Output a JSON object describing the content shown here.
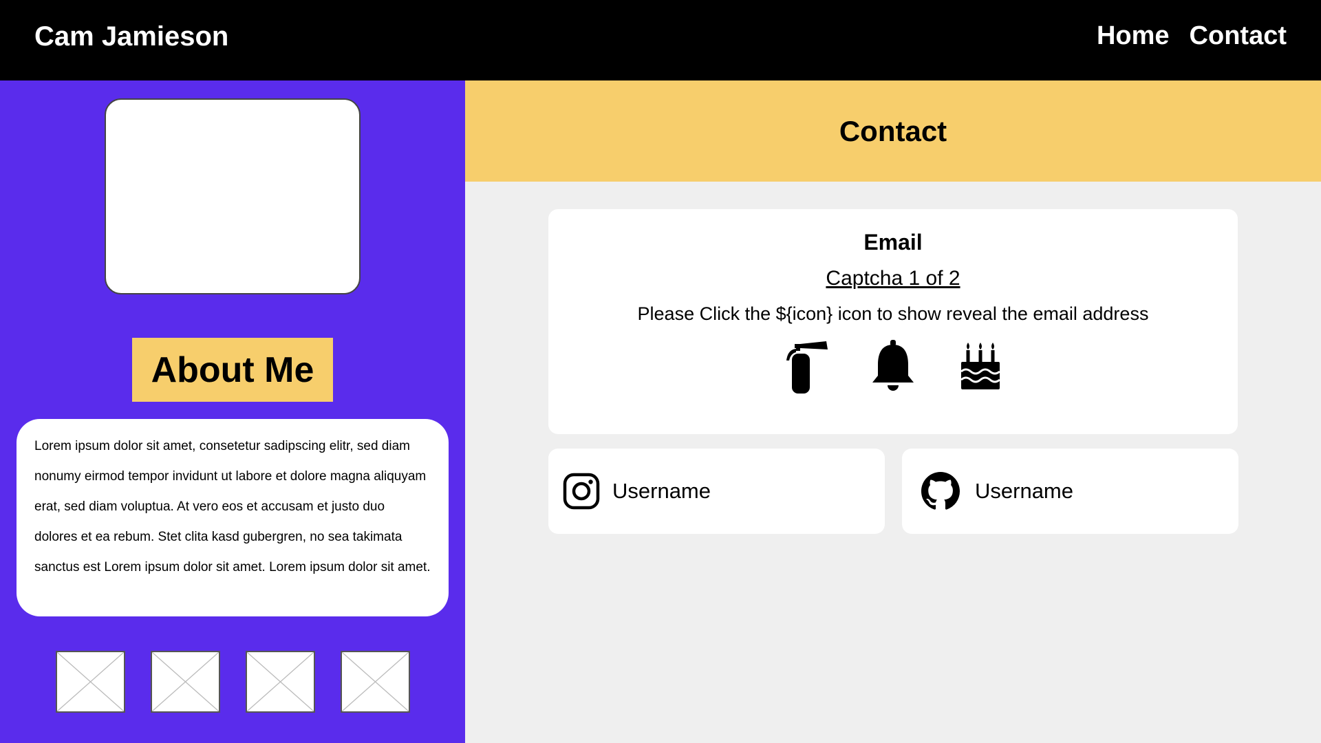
{
  "colors": {
    "topbar": "#000000",
    "sidebar": "#5a2cec",
    "accent": "#f7ce6c",
    "content_bg": "#efefef",
    "card": "#ffffff"
  },
  "header": {
    "brand": "Cam Jamieson",
    "nav": [
      {
        "label": "Home"
      },
      {
        "label": "Contact"
      }
    ]
  },
  "sidebar": {
    "about_title": "About Me",
    "bio": "Lorem ipsum dolor sit amet, consetetur sadipscing elitr, sed diam nonumy eirmod tempor invidunt ut labore et dolore magna aliquyam erat, sed diam voluptua. At vero eos et accusam et justo duo dolores et ea rebum. Stet clita kasd gubergren, no sea takimata sanctus est Lorem ipsum dolor sit amet. Lorem ipsum dolor sit amet.",
    "gallery_count": 4
  },
  "main": {
    "title": "Contact",
    "email": {
      "title": "Email",
      "captcha_link": "Captcha 1 of 2",
      "instruction": "Please Click the ${icon} icon to show reveal the email address",
      "icons": [
        "fire-extinguisher-icon",
        "bell-icon",
        "birthday-cake-icon"
      ]
    },
    "socials": [
      {
        "icon": "instagram-icon",
        "username": "Username"
      },
      {
        "icon": "github-icon",
        "username": "Username"
      }
    ]
  }
}
